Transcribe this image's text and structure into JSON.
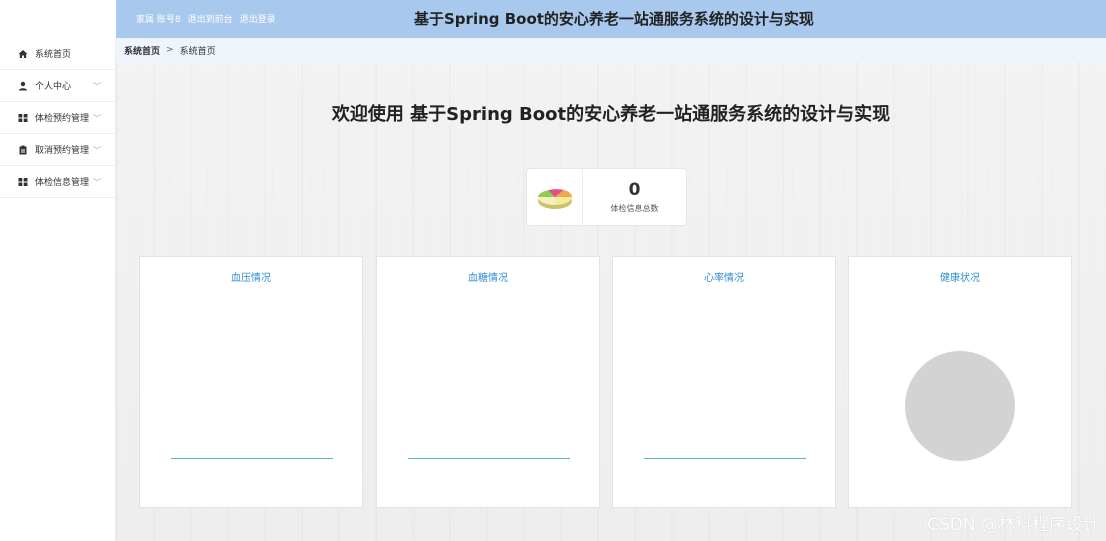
{
  "header": {
    "links": [
      "家属 账号8",
      "退出到前台",
      "退出登录"
    ],
    "title": "基于Spring Boot的安心养老一站通服务系统的设计与实现"
  },
  "sidebar": {
    "items": [
      {
        "label": "系统首页",
        "icon": "home-icon",
        "has_children": false
      },
      {
        "label": "个人中心",
        "icon": "user-icon",
        "has_children": true
      },
      {
        "label": "体检预约管理",
        "icon": "grid-icon",
        "has_children": true
      },
      {
        "label": "取消预约管理",
        "icon": "clipboard-icon",
        "has_children": true
      },
      {
        "label": "体检信息管理",
        "icon": "grid-icon",
        "has_children": true
      }
    ]
  },
  "breadcrumb": {
    "root": "系统首页",
    "separator": ">",
    "current": "系统首页"
  },
  "welcome": {
    "text": "欢迎使用 基于Spring Boot的安心养老一站通服务系统的设计与实现"
  },
  "stat": {
    "value": "0",
    "label": "体检信息总数",
    "icon": "pie-chart-icon"
  },
  "cards": [
    {
      "title": "血压情况",
      "kind": "line"
    },
    {
      "title": "血糖情况",
      "kind": "line"
    },
    {
      "title": "心率情况",
      "kind": "line"
    },
    {
      "title": "健康状况",
      "kind": "pie"
    }
  ],
  "watermark": "CSDN @林科程序设计",
  "colors": {
    "header_bg": "#a8c8ee",
    "breadcrumb_bg": "#eef4fb",
    "card_title": "#2f8ecf",
    "axis_line": "#5bb5c5",
    "pie_empty": "#d3d3d3"
  }
}
